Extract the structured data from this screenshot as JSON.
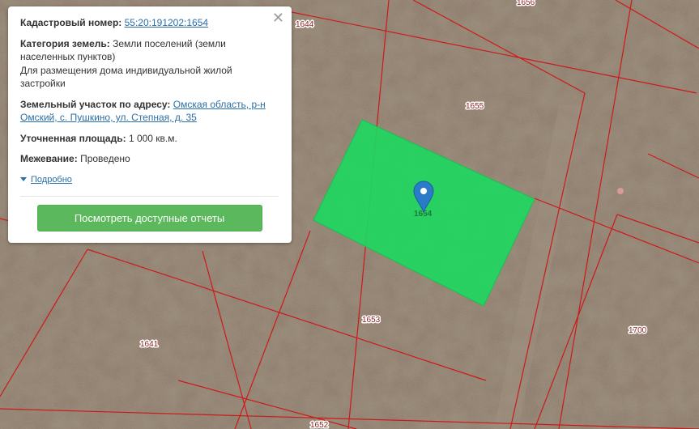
{
  "map": {
    "parcels": [
      {
        "number": "1644"
      },
      {
        "number": "1656"
      },
      {
        "number": "1655"
      },
      {
        "number": "1653"
      },
      {
        "number": "1641"
      },
      {
        "number": "1700"
      },
      {
        "number": "1652"
      }
    ],
    "selected_parcel": {
      "number": "1654",
      "color": "#1ed760"
    },
    "boundary_color": "#cc1a1a",
    "marker_color": "#2b7cc8"
  },
  "popup": {
    "cadastral_label": "Кадастровый номер:",
    "cadastral_value": "55:20:191202:1654",
    "category_label": "Категория земель:",
    "category_value": "Земли поселений (земли населенных пунктов)",
    "usage_value": "Для размещения дома индивидуальной жилой застройки",
    "address_label": "Земельный участок по адресу:",
    "address_value": "Омская область, р-н Омский, с. Пушкино, ул. Степная, д. 35",
    "area_label": "Уточненная площадь:",
    "area_value": "1 000 кв.м.",
    "survey_label": "Межевание:",
    "survey_value": "Проведено",
    "details_link": "Подробно",
    "reports_button": "Посмотреть доступные отчеты",
    "close_symbol": "✕"
  }
}
